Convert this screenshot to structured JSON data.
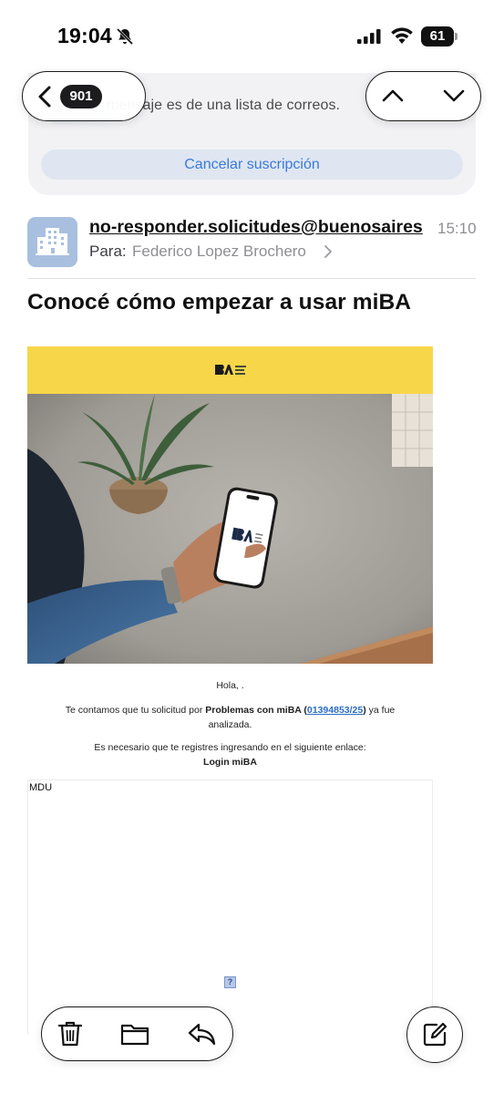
{
  "status_bar": {
    "time": "19:04",
    "battery": "61",
    "icons": [
      "bell-slash-icon",
      "signal-icon",
      "wifi-icon",
      "battery-icon"
    ]
  },
  "nav": {
    "back_count": "901",
    "icons": [
      "back-chevron-icon",
      "chevron-up-icon",
      "chevron-down-icon"
    ]
  },
  "banner": {
    "text": "mensaje es de una lista de correos.",
    "unsubscribe_label": "Cancelar suscripción"
  },
  "message": {
    "sender": "no-responder.solicitudes@buenosaires",
    "time": "15:10",
    "to_label": "Para:",
    "to_name": "Federico Lopez Brochero",
    "subject": "Conocé cómo empezar a usar miBA"
  },
  "email_body": {
    "header_color": "#f8d649",
    "greeting": "Hola, .",
    "para1_prefix": "Te contamos que tu solicitud por ",
    "para1_bold": "Problemas con miBA",
    "para1_open": " (",
    "request_number": "01394853/25",
    "para1_close": ")",
    "para1_suffix": " ya fue analizada.",
    "para2": "Es necesario que te registres ingresando en el siguiente enlace:",
    "login_link": "Login miBA",
    "mdu_label": "MDU",
    "broken_image_glyph": "?"
  },
  "toolbar": {
    "icons": [
      "trash-icon",
      "folder-icon",
      "reply-icon",
      "compose-icon"
    ]
  }
}
